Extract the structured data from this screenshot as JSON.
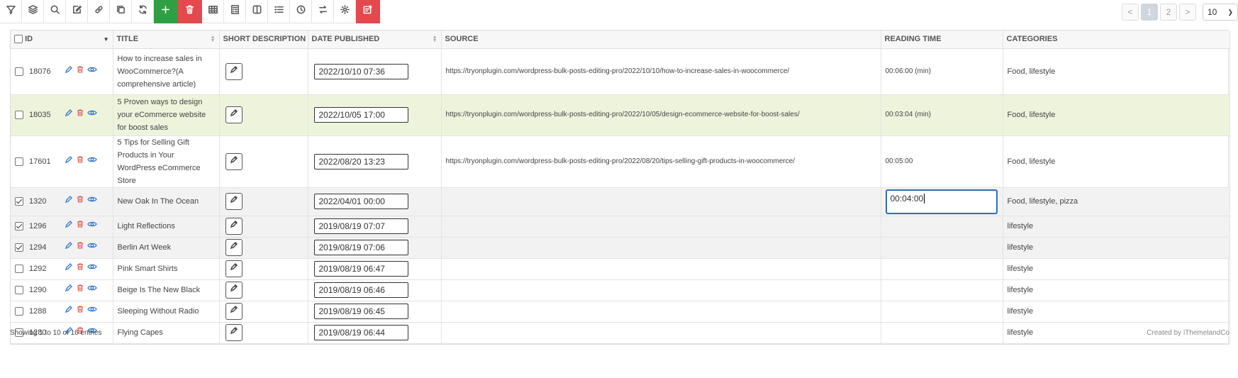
{
  "toolbar": {
    "icons": [
      "filter-icon",
      "layers-icon",
      "search-icon",
      "edit-icon",
      "link-icon",
      "copy-icon",
      "refresh-icon",
      "plus-icon",
      "trash-icon",
      "table-icon",
      "calculator-icon",
      "columns-icon",
      "list-icon",
      "history-icon",
      "swap-icon",
      "gear-icon",
      "bulk-edit-icon"
    ]
  },
  "pager": {
    "prev": "<",
    "pages": [
      "1",
      "2"
    ],
    "next": ">",
    "per_page": "10"
  },
  "table": {
    "headers": {
      "id": "ID",
      "title": "TITLE",
      "short_description": "SHORT DESCRIPTION",
      "date_published": "DATE PUBLISHED",
      "source": "SOURCE",
      "reading_time": "READING TIME",
      "categories": "CATEGORIES"
    },
    "rows": [
      {
        "checked": false,
        "id": "18076",
        "title": "How to increase sales in WooCommerce?(A comprehensive article)",
        "date": "2022/10/10 07:36",
        "source": "https://tryonplugin.com/wordpress-bulk-posts-editing-pro/2022/10/10/how-to-increase-sales-in-woocommerce/",
        "reading_time": "00:06:00 (min)",
        "categories": "Food, lifestyle",
        "style": ""
      },
      {
        "checked": false,
        "id": "18035",
        "title": "5 Proven ways to design your eCommerce website for boost sales",
        "date": "2022/10/05 17:00",
        "source": "https://tryonplugin.com/wordpress-bulk-posts-editing-pro/2022/10/05/design-ecommerce-website-for-boost-sales/",
        "reading_time": "00:03:04 (min)",
        "categories": "Food, lifestyle",
        "style": "hl"
      },
      {
        "checked": false,
        "id": "17601",
        "title": "5 Tips for Selling Gift Products in Your WordPress eCommerce Store",
        "date": "2022/08/20 13:23",
        "source": "https://tryonplugin.com/wordpress-bulk-posts-editing-pro/2022/08/20/tips-selling-gift-products-in-woocommerce/",
        "reading_time": "00:05:00",
        "categories": "Food, lifestyle",
        "style": ""
      },
      {
        "checked": true,
        "id": "1320",
        "title": "New Oak In The Ocean",
        "date": "2022/04/01 00:00",
        "source": "",
        "reading_time": "00:04:00",
        "categories": "Food, lifestyle, pizza",
        "style": "gray",
        "editing": true
      },
      {
        "checked": true,
        "id": "1296",
        "title": "Light Reflections",
        "date": "2019/08/19 07:07",
        "source": "",
        "reading_time": "",
        "categories": "lifestyle",
        "style": "gray"
      },
      {
        "checked": true,
        "id": "1294",
        "title": "Berlin Art Week",
        "date": "2019/08/19 07:06",
        "source": "",
        "reading_time": "",
        "categories": "lifestyle",
        "style": "gray"
      },
      {
        "checked": false,
        "id": "1292",
        "title": "Pink Smart Shirts",
        "date": "2019/08/19 06:47",
        "source": "",
        "reading_time": "",
        "categories": "lifestyle",
        "style": ""
      },
      {
        "checked": false,
        "id": "1290",
        "title": "Beige Is The New Black",
        "date": "2019/08/19 06:46",
        "source": "",
        "reading_time": "",
        "categories": "lifestyle",
        "style": ""
      },
      {
        "checked": false,
        "id": "1288",
        "title": "Sleeping Without Radio",
        "date": "2019/08/19 06:45",
        "source": "",
        "reading_time": "",
        "categories": "lifestyle",
        "style": ""
      },
      {
        "checked": false,
        "id": "1280",
        "title": "Flying Capes",
        "date": "2019/08/19 06:44",
        "source": "",
        "reading_time": "",
        "categories": "lifestyle",
        "style": ""
      }
    ]
  },
  "footer": {
    "showing": "Showing 1 to 10 of 16 entries",
    "credit": "Created by iThemelandCo"
  },
  "colors": {
    "add": "#2ea043",
    "delete": "#e5484d",
    "edit_icon": "#3b7fd0",
    "delete_icon": "#d9534f",
    "view_icon": "#3b7fd0",
    "highlight": "#eef4dc",
    "focus": "#2e6fb5"
  }
}
